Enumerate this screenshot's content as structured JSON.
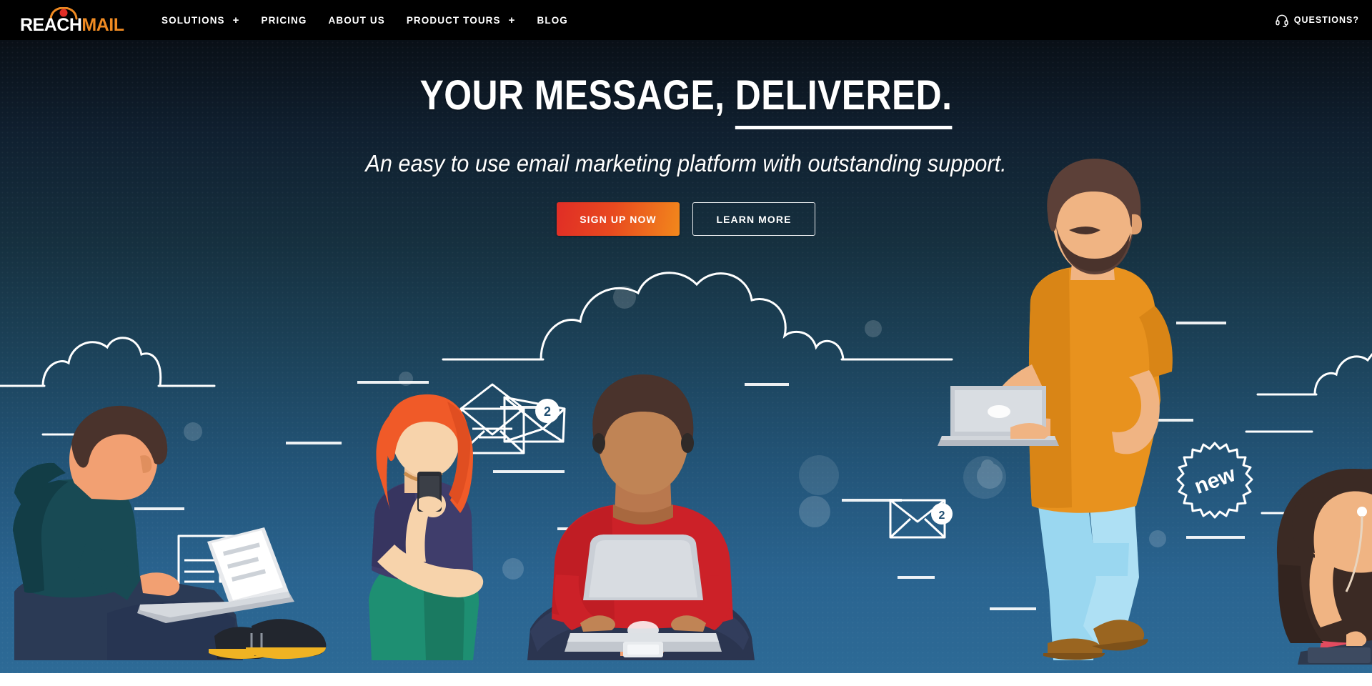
{
  "brand": {
    "name_part1": "REACH",
    "name_part2": "MAIL",
    "logo_icon": "person-figure-icon"
  },
  "nav": {
    "items": [
      {
        "label": "SOLUTIONS",
        "has_dropdown": true,
        "plus": "+"
      },
      {
        "label": "PRICING",
        "has_dropdown": false,
        "plus": ""
      },
      {
        "label": "ABOUT US",
        "has_dropdown": false,
        "plus": ""
      },
      {
        "label": "PRODUCT TOURS",
        "has_dropdown": true,
        "plus": "+"
      },
      {
        "label": "BLOG",
        "has_dropdown": false,
        "plus": ""
      }
    ],
    "support": {
      "label": "QUESTIONS?",
      "icon": "headset-icon"
    }
  },
  "hero": {
    "headline_plain": "YOUR MESSAGE, ",
    "headline_underlined": "DELIVERED.",
    "subhead": "An easy to use email marketing platform with outstanding support.",
    "primary_cta": "SIGN UP NOW",
    "secondary_cta": "LEARN MORE"
  },
  "illustration": {
    "badge_new_label": "new",
    "envelope_badge_1": "2",
    "envelope_badge_2": "2",
    "video_icon": "play-triangle-icon",
    "figures": [
      {
        "name": "seated-man-hoodie",
        "shirt": "#184a54",
        "pants": "#2b3a55",
        "shoe_accent": "#f0b323"
      },
      {
        "name": "seated-woman-phone",
        "hair": "#f05a28",
        "top": "#3f3d6b",
        "pants": "#1e8f72"
      },
      {
        "name": "seated-man-red-sweater",
        "top": "#cc2128",
        "pants": "#2b3550"
      },
      {
        "name": "standing-man-laptop",
        "shirt": "#e8921e",
        "pants": "#9ad7f0",
        "shoes": "#9a6520"
      },
      {
        "name": "seated-woman-tablet",
        "hair": "#3b2a24",
        "top": "#e34b5f"
      }
    ]
  },
  "colors": {
    "navbar_bg": "#000000",
    "brand_orange": "#ef8a22",
    "cta_gradient_start": "#e02d26",
    "cta_gradient_end": "#f2881c",
    "hero_top": "#05070a",
    "hero_bottom": "#2d6a96",
    "text_white": "#ffffff"
  }
}
